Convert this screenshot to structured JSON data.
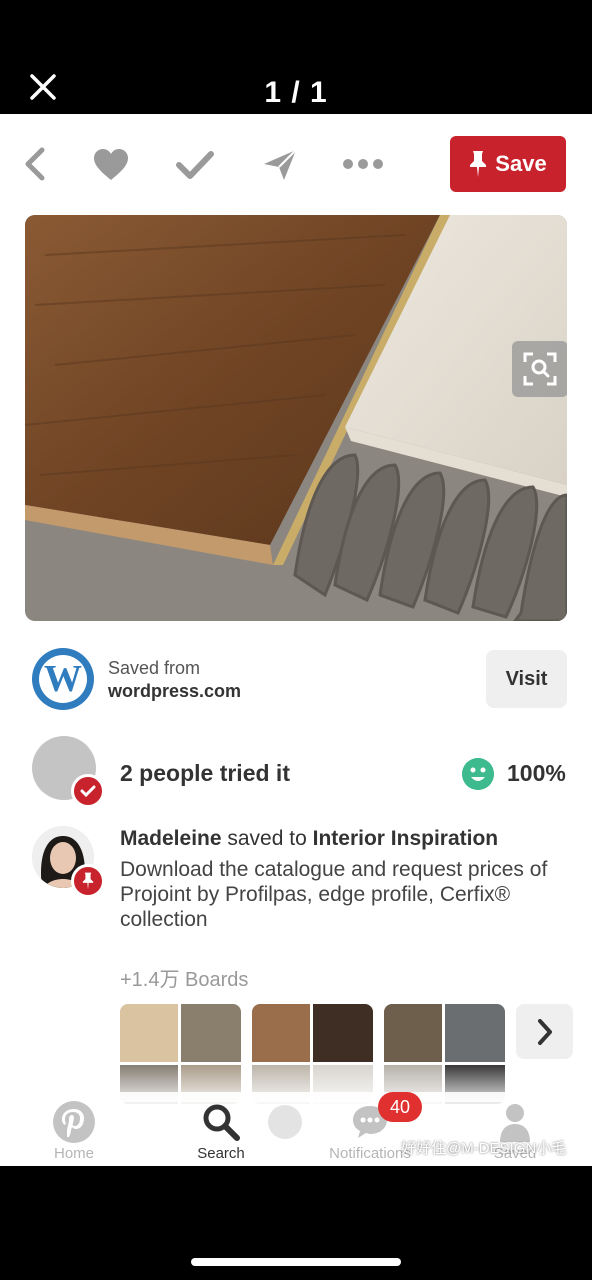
{
  "viewer": {
    "counter": "1 / 1"
  },
  "actions": {
    "save_label": "Save"
  },
  "source": {
    "saved_from": "Saved from",
    "domain": "wordpress.com",
    "visit_label": "Visit",
    "logo_letter": "W"
  },
  "tried": {
    "text": "2 people tried it",
    "percent": "100%"
  },
  "saver": {
    "name": "Madeleine",
    "verb": " saved to ",
    "board": "Interior Inspiration",
    "description": "Download the catalogue and request prices of Projoint by Profilpas, edge profile, Cerfix® collection",
    "boards_count": "+1.4万 Boards"
  },
  "tabs": [
    {
      "label": "Home",
      "icon": "pinterest-icon"
    },
    {
      "label": "Search",
      "icon": "search-icon"
    },
    {
      "label": "",
      "icon": "profile-icon"
    },
    {
      "label": "Notifications",
      "icon": "speech-bubble-icon"
    },
    {
      "label": "Saved",
      "icon": "person-icon"
    }
  ],
  "notifications_badge": "40",
  "watermark": "好好住@M-DESIGN小毛",
  "colors": {
    "accent": "#c8232c",
    "badge": "#e0302f",
    "wordpress": "#2f7cbf",
    "smiley": "#3dbb8f"
  }
}
